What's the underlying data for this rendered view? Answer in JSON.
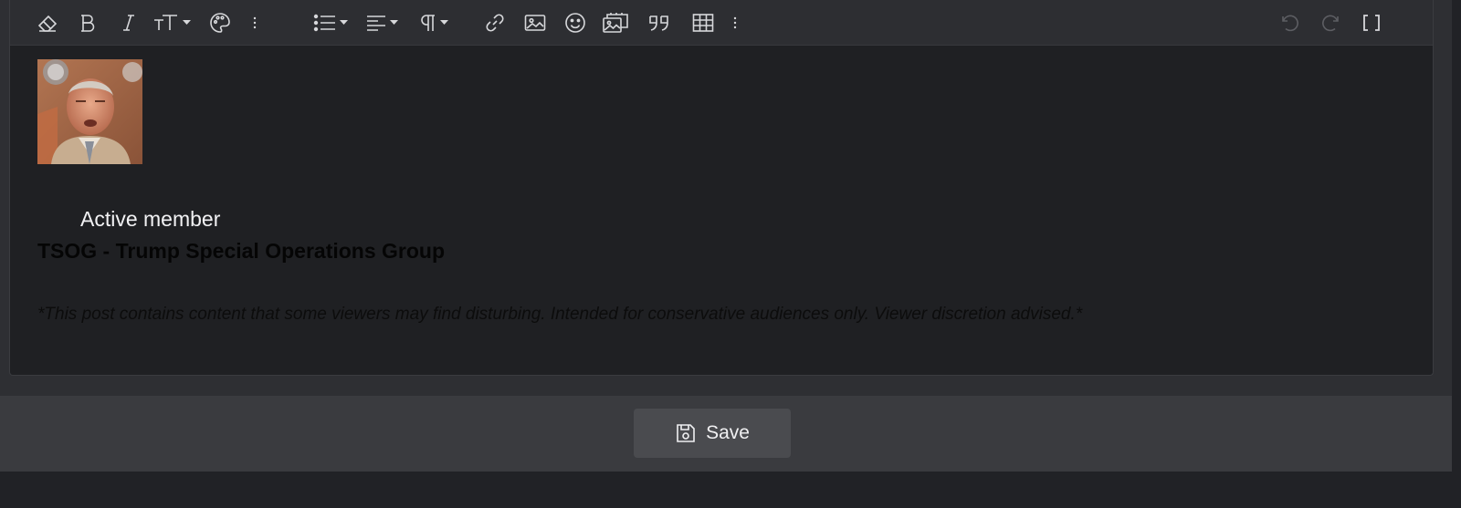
{
  "toolbar": {
    "buttons": [
      {
        "name": "clear-formatting",
        "icon": "eraser-icon"
      },
      {
        "name": "bold",
        "icon": "bold-icon"
      },
      {
        "name": "italic",
        "icon": "italic-icon"
      },
      {
        "name": "font-size",
        "icon": "text-size-icon",
        "dropdown": true
      },
      {
        "name": "text-color",
        "icon": "palette-icon"
      },
      {
        "name": "more-text",
        "icon": "vertical-ellipsis-icon"
      },
      {
        "name": "list",
        "icon": "list-icon",
        "dropdown": true
      },
      {
        "name": "align",
        "icon": "align-left-icon",
        "dropdown": true
      },
      {
        "name": "paragraph",
        "icon": "paragraph-icon",
        "dropdown": true
      },
      {
        "name": "insert-link",
        "icon": "link-icon"
      },
      {
        "name": "insert-image",
        "icon": "image-icon"
      },
      {
        "name": "smilies",
        "icon": "smiley-icon"
      },
      {
        "name": "media",
        "icon": "media-gallery-icon"
      },
      {
        "name": "quote",
        "icon": "quote-icon"
      },
      {
        "name": "table",
        "icon": "table-icon"
      },
      {
        "name": "more-insert",
        "icon": "vertical-ellipsis-icon"
      },
      {
        "name": "undo",
        "icon": "undo-icon",
        "disabled": true
      },
      {
        "name": "redo",
        "icon": "redo-icon",
        "disabled": true
      },
      {
        "name": "toggle-bbcode",
        "icon": "brackets-icon"
      }
    ]
  },
  "content": {
    "rank": "Active member",
    "group": "TSOG - Trump Special Operations Group",
    "disclaimer": "*This post contains content that some viewers may find disturbing. Intended for conservative audiences only. Viewer discretion advised.*"
  },
  "footer": {
    "save_label": "Save"
  },
  "colors": {
    "page_bg": "#212226",
    "editor_bg": "#1f2023",
    "toolbar_bg": "#2d2e32",
    "footer_bg": "#3a3b3f",
    "button_bg": "#4a4b4f",
    "icon_color": "#d7d8db"
  }
}
